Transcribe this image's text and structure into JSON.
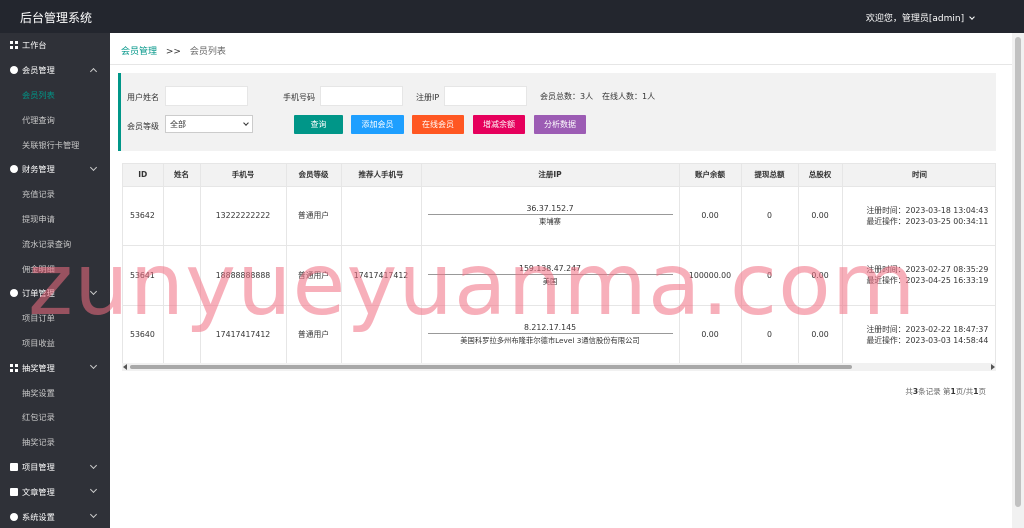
{
  "header": {
    "title": "后台管理系统",
    "user_text": "欢迎您，管理员[admin]"
  },
  "sidebar": {
    "items": [
      {
        "label": "工作台",
        "type": "group",
        "icon": "grid-icon"
      },
      {
        "label": "会员管理",
        "type": "group",
        "icon": "circle-icon",
        "expanded": true
      },
      {
        "label": "会员列表",
        "type": "sub",
        "active": true
      },
      {
        "label": "代理查询",
        "type": "sub"
      },
      {
        "label": "关联银行卡管理",
        "type": "sub"
      },
      {
        "label": "财务管理",
        "type": "group",
        "icon": "circle-icon",
        "expanded": false
      },
      {
        "label": "充值记录",
        "type": "sub"
      },
      {
        "label": "提现申请",
        "type": "sub"
      },
      {
        "label": "流水记录查询",
        "type": "sub"
      },
      {
        "label": "佣金明细",
        "type": "sub"
      },
      {
        "label": "订单管理",
        "type": "group",
        "icon": "circle-icon",
        "expanded": false
      },
      {
        "label": "项目订单",
        "type": "sub"
      },
      {
        "label": "项目收益",
        "type": "sub"
      },
      {
        "label": "抽奖管理",
        "type": "group",
        "icon": "grid-icon",
        "expanded": false
      },
      {
        "label": "抽奖设置",
        "type": "sub"
      },
      {
        "label": "红包记录",
        "type": "sub"
      },
      {
        "label": "抽奖记录",
        "type": "sub"
      },
      {
        "label": "项目管理",
        "type": "group",
        "icon": "doc-icon",
        "expanded": false
      },
      {
        "label": "文章管理",
        "type": "group",
        "icon": "doc-icon",
        "expanded": false
      },
      {
        "label": "系统设置",
        "type": "group",
        "icon": "circle-icon",
        "expanded": false
      }
    ]
  },
  "breadcrumb": {
    "parent": "会员管理",
    "sep": ">>",
    "current": "会员列表"
  },
  "filter": {
    "username_label": "用户姓名",
    "username_value": "",
    "phone_label": "手机号码",
    "phone_value": "",
    "ip_label": "注册IP",
    "ip_value": "",
    "total_members": "会员总数：3人",
    "online_members": "在线人数：1人",
    "level_label": "会员等级",
    "level_selected": "全部"
  },
  "buttons": [
    {
      "label": "查询",
      "color": "#009688"
    },
    {
      "label": "添加会员",
      "color": "#1e9fff"
    },
    {
      "label": "在线会员",
      "color": "#ff5722"
    },
    {
      "label": "增减余额",
      "color": "#e6005c"
    },
    {
      "label": "分析数据",
      "color": "#9c5cb4"
    }
  ],
  "table": {
    "headers": [
      "ID",
      "姓名",
      "手机号",
      "会员等级",
      "推荐人手机号",
      "注册IP",
      "账户余额",
      "提现总额",
      "总股权",
      "时间"
    ],
    "rows": [
      {
        "id": "53642",
        "name": "",
        "phone": "13222222222",
        "level": "普通用户",
        "referrer": "",
        "ip": "36.37.152.7",
        "ip_loc": "柬埔寨",
        "balance": "0.00",
        "withdraw": "0",
        "equity": "0.00",
        "reg_time": "注册时间：2023-03-18 13:04:43",
        "last_op": "最近操作：2023-03-25 00:34:11"
      },
      {
        "id": "53641",
        "name": "",
        "phone": "18888888888",
        "level": "普通用户",
        "referrer": "17417417412",
        "ip": "159.138.47.247",
        "ip_loc": "美国",
        "balance": "100000.00",
        "withdraw": "0",
        "equity": "0.00",
        "reg_time": "注册时间：2023-02-27 08:35:29",
        "last_op": "最近操作：2023-04-25 16:33:19"
      },
      {
        "id": "53640",
        "name": "",
        "phone": "17417417412",
        "level": "普通用户",
        "referrer": "",
        "ip": "8.212.17.145",
        "ip_loc": "美国科罗拉多州布隆菲尔德市Level 3通信股份有限公司",
        "balance": "0.00",
        "withdraw": "0",
        "equity": "0.00",
        "reg_time": "注册时间：2023-02-22 18:47:37",
        "last_op": "最近操作：2023-03-03 14:58:44"
      }
    ]
  },
  "pager": {
    "prefix": "共",
    "count": "3",
    "mid": "条记录 第",
    "page": "1",
    "mid2": "页/共",
    "pages": "1",
    "suffix": "页"
  },
  "watermark": "zunyueyuanma.com"
}
